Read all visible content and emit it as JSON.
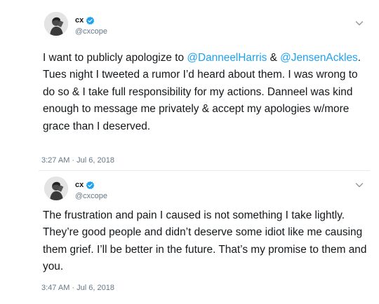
{
  "tweets": [
    {
      "author": {
        "display_name": "cx",
        "handle": "@cxcope",
        "avatar": "person-avatar-icon",
        "verified_icon": "verified-badge-icon"
      },
      "menu_icon": "chevron-down-icon",
      "text": {
        "p1": "I want to publicly apologize to ",
        "m1": "@DanneelHarris",
        "p2": " & ",
        "m2": "@JensenAckles",
        "p3": ". Tues night I tweeted a rumor I’d heard about them. I was wrong to do so & I take full responsibility for my actions. Danneel was kind enough to message me privately & accept my apologies w/more grace than I deserved."
      },
      "timestamp": "3:27 AM · Jul 6, 2018"
    },
    {
      "author": {
        "display_name": "cx",
        "handle": "@cxcope",
        "avatar": "person-avatar-icon",
        "verified_icon": "verified-badge-icon"
      },
      "menu_icon": "chevron-down-icon",
      "text": {
        "p1": "The frustration and pain I caused is not something I take lightly. They’re good people and didn’t deserve some idiot like me causing them grief. I’ll be better in the future. That’s my promise to them and you."
      },
      "timestamp": "3:47 AM · Jul 6, 2018"
    }
  ],
  "colors": {
    "mention": "#1da1f2",
    "text": "#14171a",
    "muted": "#657786",
    "divider": "#e6ecf0",
    "verified": "#1da1f2"
  }
}
